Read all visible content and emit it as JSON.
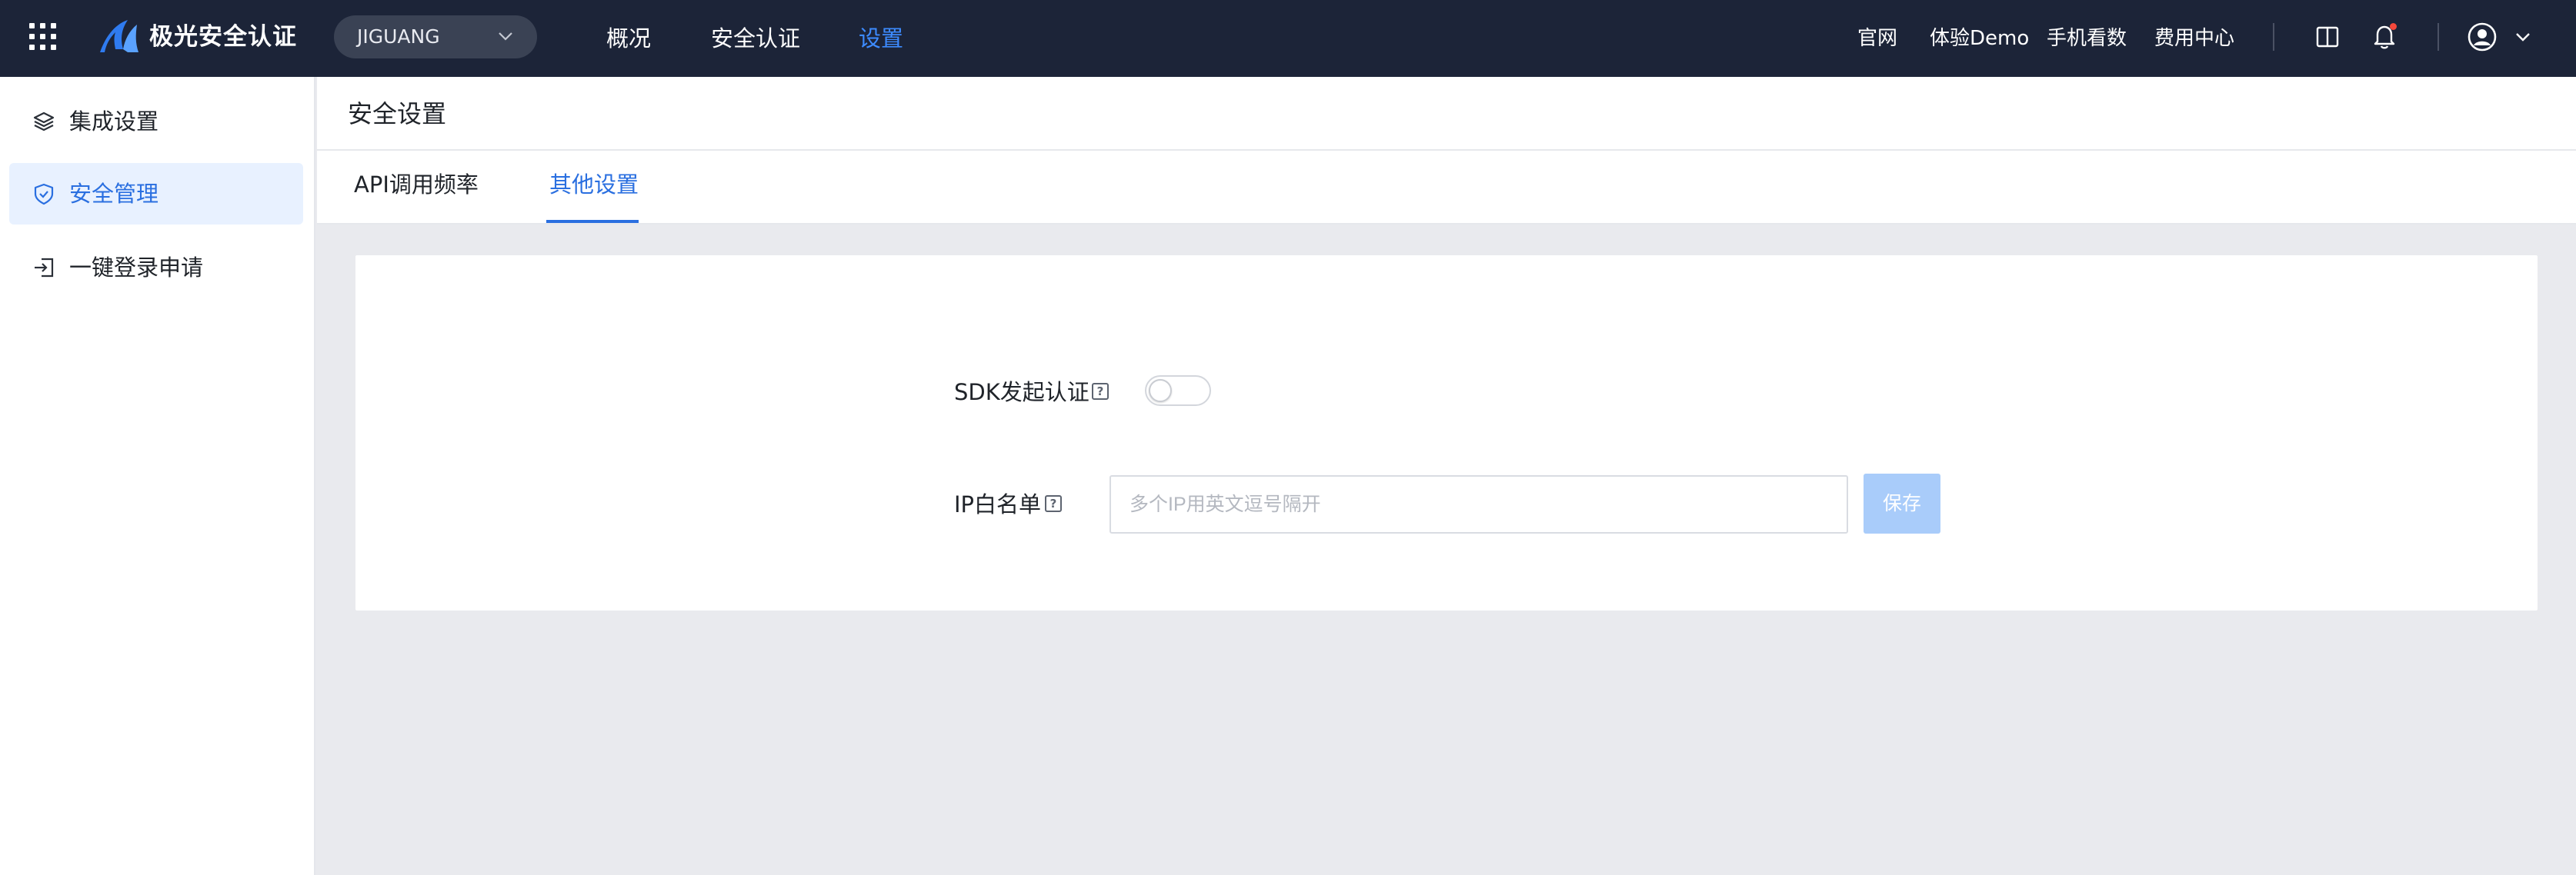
{
  "header": {
    "app_title": "极光安全认证",
    "app_selector": {
      "value": "JIGUANG"
    },
    "nav": [
      {
        "label": "概况",
        "active": false
      },
      {
        "label": "安全认证",
        "active": false
      },
      {
        "label": "设置",
        "active": true
      }
    ],
    "links": [
      "官网",
      "体验Demo",
      "手机看数",
      "费用中心"
    ],
    "icons": [
      "apps-grid-icon",
      "book-icon",
      "bell-icon",
      "user-avatar-icon",
      "chevron-down-icon"
    ]
  },
  "sidebar": {
    "items": [
      {
        "label": "集成设置",
        "icon": "layers-icon",
        "active": false
      },
      {
        "label": "安全管理",
        "icon": "shield-icon",
        "active": true
      },
      {
        "label": "一键登录申请",
        "icon": "login-icon",
        "active": false
      }
    ]
  },
  "page": {
    "title": "安全设置",
    "tabs": [
      {
        "label": "API调用频率",
        "active": false
      },
      {
        "label": "其他设置",
        "active": true
      }
    ]
  },
  "form": {
    "sdk_auth": {
      "label": "SDK发起认证",
      "help": "?",
      "enabled": false
    },
    "ip_whitelist": {
      "label": "IP白名单",
      "help": "?",
      "value": "",
      "placeholder": "多个IP用英文逗号隔开"
    },
    "save_label": "保存"
  },
  "colors": {
    "topbar_bg": "#1c2438",
    "accent": "#2a6fe0",
    "nav_active": "#3d8bff",
    "content_bg": "#e9eaee",
    "save_disabled": "#a9ccfa",
    "notification_dot": "#f5483b"
  }
}
